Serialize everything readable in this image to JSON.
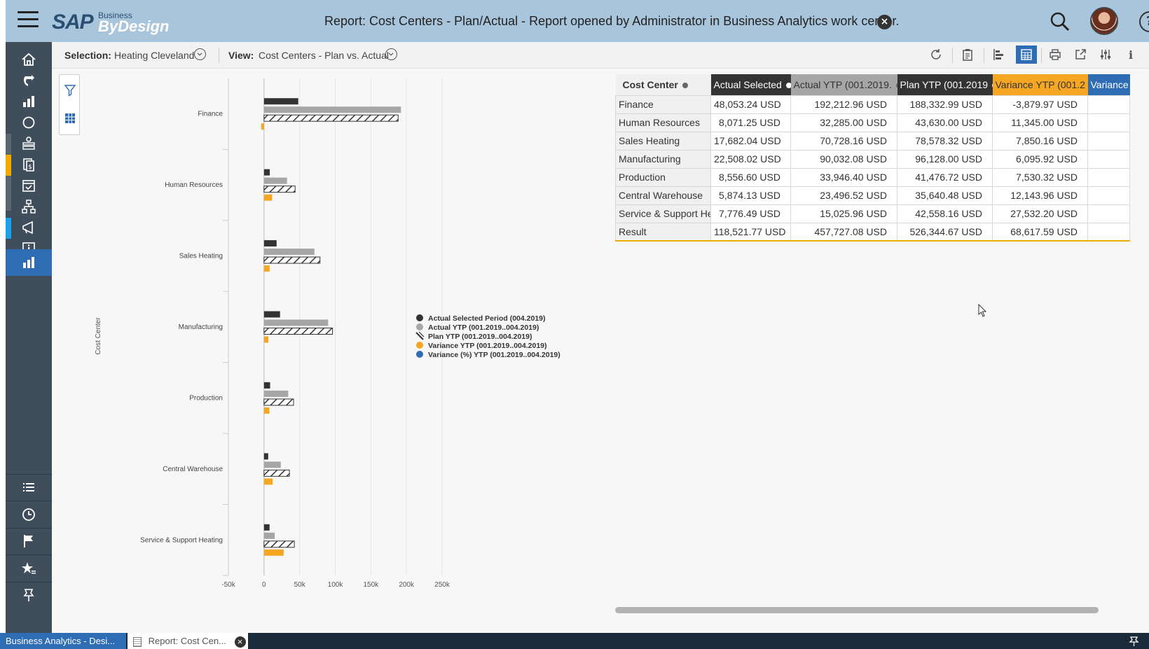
{
  "header": {
    "logo_sap": "SAP",
    "logo_business": "Business",
    "logo_bydesign": "ByDesign",
    "title": "Report: Cost Centers - Plan/Actual - Report opened by Administrator in Business Analytics work center.",
    "icons": [
      "menu-icon",
      "close-icon",
      "search-icon",
      "user-avatar",
      "help-icon"
    ],
    "help_label": "?"
  },
  "sidenav": {
    "items": [
      "home-icon",
      "refresh-icon",
      "dashboard-icon",
      "circle-icon",
      "org-icon",
      "finance-doc-icon",
      "calendar-icon",
      "hierarchy-icon",
      "megaphone-icon",
      "info-icon",
      "bar-chart-icon"
    ],
    "bottom_items": [
      "list-icon",
      "clock-icon",
      "flag-icon",
      "favorites-icon",
      "pin-icon"
    ],
    "active": "bar-chart-icon"
  },
  "toolbar": {
    "selection_label": "Selection:",
    "selection_value": "Heating Cleveland",
    "view_label": "View:",
    "view_value": "Cost Centers - Plan vs. Actual",
    "icons": [
      "refresh-icon",
      "clipboard-icon",
      "bar-chart-icon",
      "table-icon",
      "print-icon",
      "export-icon",
      "settings-icon",
      "info-icon"
    ],
    "info_label": "i"
  },
  "chart_data": {
    "type": "bar",
    "orientation": "horizontal",
    "ylabel": "Cost Center",
    "categories": [
      "Finance",
      "Human Resources",
      "Sales Heating",
      "Manufacturing",
      "Production",
      "Central Warehouse",
      "Service & Support Heating"
    ],
    "xticks": [
      "-50k",
      "0",
      "50k",
      "100k",
      "150k",
      "200k",
      "250k"
    ],
    "xlim": [
      -50000,
      250000
    ],
    "grid": true,
    "legend_placement": "right",
    "series": [
      {
        "name": "Actual Selected Period (004.2019)",
        "color": "#333333",
        "pattern": "solid",
        "values": [
          48053.24,
          8071.25,
          17682.04,
          22508.02,
          8556.6,
          5874.13,
          7776.49
        ]
      },
      {
        "name": "Actual YTP (001.2019..004.2019)",
        "color": "#a6a6a6",
        "pattern": "solid",
        "values": [
          192212.96,
          32285.0,
          70728.16,
          90032.08,
          33946.4,
          23496.52,
          15025.96
        ]
      },
      {
        "name": "Plan YTP (001.2019..004.2019)",
        "color": "#333333",
        "pattern": "hatched",
        "values": [
          188332.99,
          43630.0,
          78578.32,
          96128.0,
          41476.72,
          35640.48,
          42558.16
        ]
      },
      {
        "name": "Variance YTP (001.2019..004.2019)",
        "color": "#f5a623",
        "pattern": "solid",
        "values": [
          -3879.97,
          11345.0,
          7850.16,
          6095.92,
          7530.32,
          12143.96,
          27532.2
        ]
      },
      {
        "name": "Variance (%) YTP (001.2019..004.2019)",
        "color": "#2e6db4",
        "pattern": "solid",
        "values": []
      }
    ]
  },
  "table": {
    "headers": [
      {
        "label": "Cost Center",
        "bg": "#f0f0f0",
        "fg": "#333333",
        "bold": true,
        "dot": "#666666"
      },
      {
        "label": "Actual Selected",
        "bg": "#333333",
        "fg": "#ffffff",
        "bold": false,
        "dot": "#ffffff"
      },
      {
        "label": "Actual YTP (001.2019.",
        "bg": "#a6a6a6",
        "fg": "#333333",
        "bold": false,
        "dot": "#666666"
      },
      {
        "label": "Plan YTP (001.2019",
        "bg": "#333333",
        "fg": "#ffffff",
        "bold": false,
        "dot": "#ffffff"
      },
      {
        "label": "Variance YTP (001.2",
        "bg": "#f5a623",
        "fg": "#333333",
        "bold": false,
        "dot": "#666666"
      },
      {
        "label": "Variance (",
        "bg": "#2e6db4",
        "fg": "#ffffff",
        "bold": false,
        "dot": ""
      }
    ],
    "rows": [
      [
        "Finance",
        "48,053.24 USD",
        "192,212.96 USD",
        "188,332.99 USD",
        "-3,879.97 USD",
        ""
      ],
      [
        "Human Resources",
        "8,071.25 USD",
        "32,285.00 USD",
        "43,630.00 USD",
        "11,345.00 USD",
        ""
      ],
      [
        "Sales Heating",
        "17,682.04 USD",
        "70,728.16 USD",
        "78,578.32 USD",
        "7,850.16 USD",
        ""
      ],
      [
        "Manufacturing",
        "22,508.02 USD",
        "90,032.08 USD",
        "96,128.00 USD",
        "6,095.92 USD",
        ""
      ],
      [
        "Production",
        "8,556.60 USD",
        "33,946.40 USD",
        "41,476.72 USD",
        "7,530.32 USD",
        ""
      ],
      [
        "Central Warehouse",
        "5,874.13 USD",
        "23,496.52 USD",
        "35,640.48 USD",
        "12,143.96 USD",
        ""
      ],
      [
        "Service & Support Heat",
        "7,776.49 USD",
        "15,025.96 USD",
        "42,558.16 USD",
        "27,532.20 USD",
        ""
      ],
      [
        "Result",
        "118,521.77 USD",
        "457,727.08 USD",
        "526,344.67 USD",
        "68,617.59 USD",
        ""
      ]
    ]
  },
  "taskbar": {
    "tab1": "Business Analytics - Desi...",
    "tab2": "Report: Cost Cen...",
    "tab2_close": "×"
  }
}
